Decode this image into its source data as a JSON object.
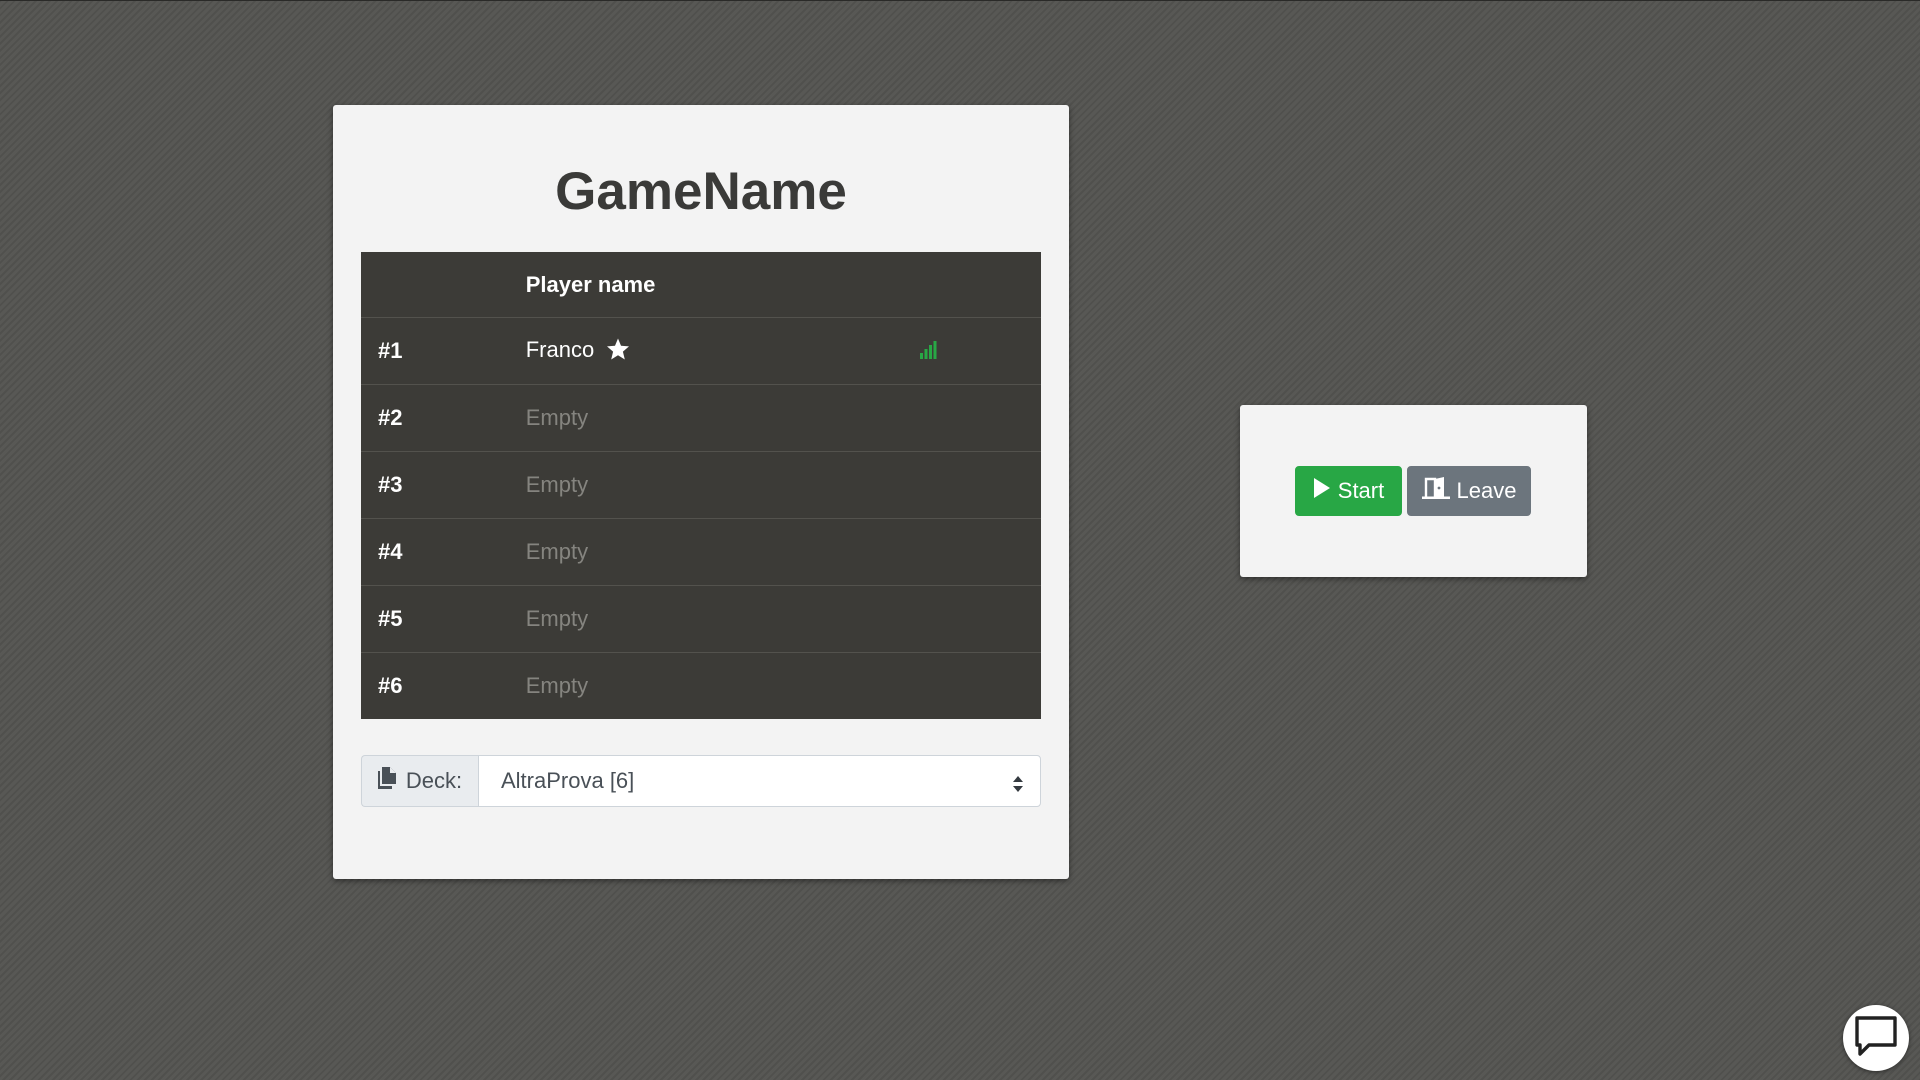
{
  "game": {
    "title": "GameName"
  },
  "table": {
    "header": {
      "number": "",
      "name": "Player name",
      "connection": ""
    },
    "rows": [
      {
        "number": "#1",
        "name": "Franco",
        "is_host": true,
        "connection_icon": "signal-bars-icon",
        "connection_color": "#28a745"
      },
      {
        "number": "#2",
        "name": "Empty"
      },
      {
        "number": "#3",
        "name": "Empty"
      },
      {
        "number": "#4",
        "name": "Empty"
      },
      {
        "number": "#5",
        "name": "Empty"
      },
      {
        "number": "#6",
        "name": "Empty"
      }
    ]
  },
  "deck": {
    "label": "Deck:",
    "icon": "copy-icon",
    "selected": "AltraProva [6]"
  },
  "actions": {
    "start_label": "Start",
    "start_icon": "play-icon",
    "leave_label": "Leave",
    "leave_icon": "door-open-icon"
  },
  "chat": {
    "icon": "chat-bubble-icon"
  },
  "colors": {
    "start": "#28a745",
    "leave": "#6c757d",
    "table_bg": "#3c3b37",
    "card_bg": "#f3f3f3"
  }
}
